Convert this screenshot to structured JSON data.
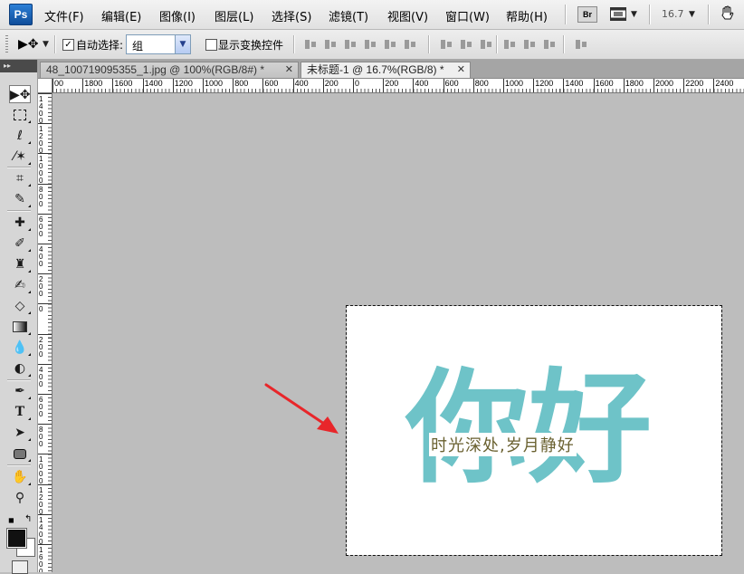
{
  "app": {
    "logo": "Ps"
  },
  "menu": {
    "items": [
      "文件(F)",
      "编辑(E)",
      "图像(I)",
      "图层(L)",
      "选择(S)",
      "滤镜(T)",
      "视图(V)",
      "窗口(W)",
      "帮助(H)"
    ],
    "bridge_label": "Br",
    "zoom_value": "16.7",
    "icons": [
      "bridge-icon",
      "screen-mode-icon",
      "hand-icon"
    ]
  },
  "options": {
    "auto_select_label": "自动选择:",
    "auto_select_checked": true,
    "auto_select_value": "组",
    "show_transform_label": "显示变换控件",
    "show_transform_checked": false
  },
  "tabs": [
    {
      "label": "48_100719095355_1.jpg @ 100%(RGB/8#) *",
      "active": false
    },
    {
      "label": "未标题-1 @ 16.7%(RGB/8) *",
      "active": true
    }
  ],
  "ruler": {
    "h_labels": [
      "00",
      "1800",
      "1600",
      "1400",
      "1200",
      "1000",
      "800",
      "600",
      "400",
      "200",
      "0",
      "200",
      "400",
      "600",
      "800",
      "1000",
      "1200",
      "1400",
      "1600",
      "1800",
      "2000",
      "2200",
      "2400"
    ],
    "v_labels": [
      "1400",
      "1200",
      "1000",
      "800",
      "600",
      "400",
      "200",
      "0",
      "200",
      "400",
      "600",
      "800",
      "1000",
      "1200",
      "1400",
      "1600"
    ]
  },
  "canvas": {
    "big_chars": [
      "你",
      "好"
    ],
    "subtitle": "时光深处,岁月静好",
    "text_color": "#6ec3c8",
    "subtitle_color": "#6a6130",
    "arrow_color": "#e8262a"
  },
  "toolbox": {
    "tools": [
      "move-tool",
      "marquee-tool",
      "lasso-tool",
      "magic-wand-tool",
      "crop-tool",
      "eyedropper-tool",
      "healing-brush-tool",
      "brush-tool",
      "clone-stamp-tool",
      "history-brush-tool",
      "eraser-tool",
      "gradient-tool",
      "blur-tool",
      "dodge-tool",
      "pen-tool",
      "type-tool",
      "path-selection-tool",
      "shape-tool",
      "hand-tool",
      "zoom-tool"
    ],
    "foreground_color": "#111111",
    "background_color": "#ffffff"
  }
}
